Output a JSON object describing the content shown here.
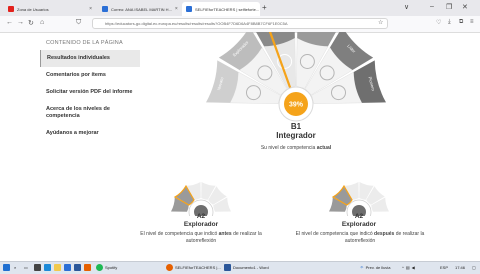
{
  "browser": {
    "tabs": [
      {
        "title": "Zona de Usuarios",
        "color": "#e2211c"
      },
      {
        "title": "Correo: ANA ISABEL MARTIN H...",
        "color": "#2b6fd6"
      },
      {
        "title": "SELFIEforTEACHERS | selfieforte...",
        "color": "#2b6fd6"
      }
    ],
    "new_tab": "+",
    "url": "https://educators-go.digital-skills.europa.eu/results/summary/results?selectedOrgId=...",
    "url_short": "https://educators-go.digital.ec.europa.eu/results/results/results?OOB4F7D6D6A4F8B8B7CF6F1E0C5A",
    "window_controls": [
      "∨",
      "–",
      "❐",
      "✕"
    ]
  },
  "sidebar": {
    "title": "CONTENIDO DE LA PÁGINA",
    "items": [
      {
        "label": "Resultados individuales",
        "active": true
      },
      {
        "label": "Comentarios por ítems",
        "active": false
      },
      {
        "label": "Solicitar versión PDF del informe",
        "active": false
      },
      {
        "label": "Acerca de los niveles de competencia",
        "active": false
      },
      {
        "label": "Ayúdanos a mejorar",
        "active": false
      }
    ]
  },
  "gauge": {
    "percent": 39,
    "percent_label": "39%",
    "segments_left": [
      "Novato",
      "Explorador",
      "Integrador"
    ],
    "segments_right": [
      "Experto",
      "Líder",
      "Pionero"
    ],
    "accent": "#f5a31a",
    "active_segment": "#7a7a7a",
    "inactive_segment": "#e1e1e1",
    "level": "B1",
    "level_name": "Integrador",
    "note_prefix": "Su nivel de competencia ",
    "note_bold": "actual"
  },
  "mini_gauges": [
    {
      "level": "A2",
      "level_name": "Explorador",
      "line1_prefix": "El nivel de competencia que indicó ",
      "line1_bold": "antes",
      "line1_suffix": " de realizar la",
      "line2": "autorreflexión"
    },
    {
      "level": "A2",
      "level_name": "Explorador",
      "line1_prefix": "El nivel de competencia que indicó ",
      "line1_bold": "después",
      "line1_suffix": " de realizar la",
      "line2": "autorreflexión"
    }
  ],
  "taskbar": {
    "apps": [
      {
        "label": "Spotify",
        "color": "#1db954"
      },
      {
        "label": "SELFIEforTEACHERS |...",
        "color": "#e66000"
      },
      {
        "label": "Documento1 - Word",
        "color": "#2b579a"
      }
    ],
    "right_items": [
      "Prev. de lluvia",
      "ESP",
      "17:46"
    ]
  }
}
